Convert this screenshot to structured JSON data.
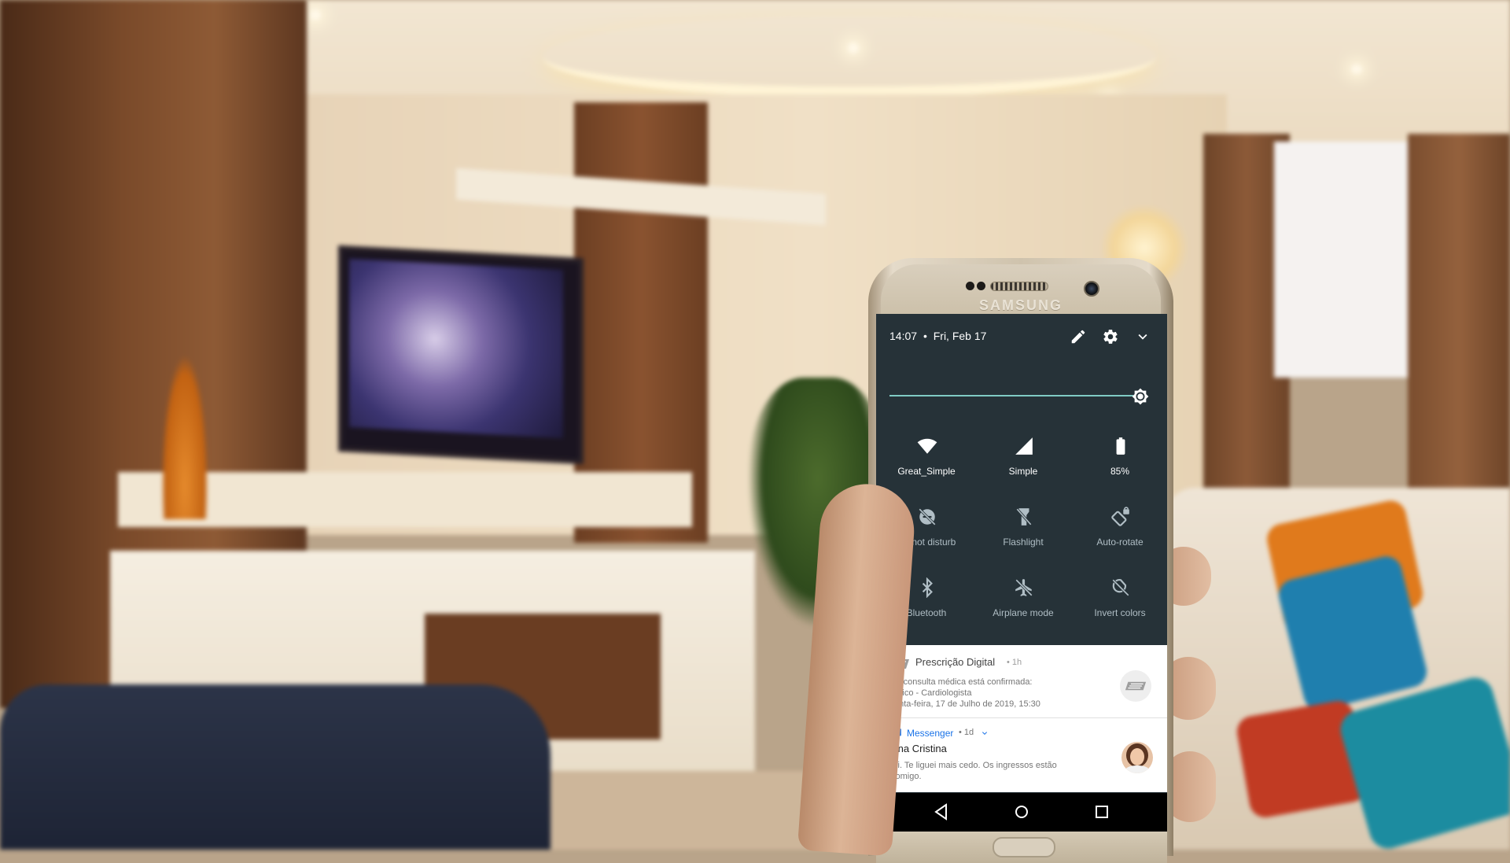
{
  "phone": {
    "brand": "SAMSUNG",
    "quick_settings": {
      "time": "14:07",
      "separator": "•",
      "date": "Fri, Feb 17",
      "header_icons": [
        "edit-icon",
        "settings-icon",
        "chevron-down-icon"
      ],
      "brightness_level": 1.0,
      "accent_color": "#80cbc4",
      "background_color": "#263238",
      "tiles": [
        {
          "label": "Great_Simple",
          "icon": "wifi-icon",
          "active": true
        },
        {
          "label": "Simple",
          "icon": "cellular-signal-icon",
          "active": true
        },
        {
          "label": "85%",
          "icon": "battery-icon",
          "active": true
        },
        {
          "label": "Do not disturb",
          "icon": "do-not-disturb-icon",
          "active": false
        },
        {
          "label": "Flashlight",
          "icon": "flashlight-icon",
          "active": false
        },
        {
          "label": "Auto-rotate",
          "icon": "auto-rotate-icon",
          "active": false
        },
        {
          "label": "Bluetooth",
          "icon": "bluetooth-icon",
          "active": false
        },
        {
          "label": "Airplane mode",
          "icon": "airplane-icon",
          "active": false
        },
        {
          "label": "Invert colors",
          "icon": "invert-colors-icon",
          "active": false
        }
      ]
    },
    "notifications": [
      {
        "app": "Prescrição Digital",
        "time": "• 1h",
        "lines": [
          "Sua consulta médica está confirmada:",
          "Médico - Cardiologista",
          "Quinta-feira, 17 de Julho de 2019, 15:30"
        ],
        "icon": "prescription-logo-icon"
      },
      {
        "app": "Messenger",
        "time": "• 1d",
        "title": "Ana Cristina",
        "message": "Oi. Te liguei mais cedo. Os ingressos estão",
        "message_cont": "comigo.",
        "app_color": "#1a73e8",
        "icon": "messenger-icon"
      }
    ],
    "nav_buttons": [
      "back-icon",
      "home-icon",
      "recents-icon"
    ]
  }
}
